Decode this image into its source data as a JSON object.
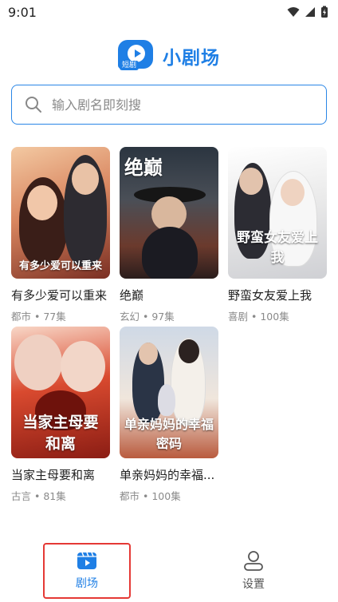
{
  "status_bar": {
    "time": "9:01"
  },
  "header": {
    "logo_tag": "短剧",
    "title": "小剧场"
  },
  "search": {
    "placeholder": "输入剧名即刻搜"
  },
  "dramas": [
    {
      "title": "有多少爱可以重来",
      "genre": "都市",
      "episodes": "77集",
      "poster_text": "有多少爱可以重来"
    },
    {
      "title": "绝巅",
      "genre": "玄幻",
      "episodes": "97集",
      "poster_text": "绝巅"
    },
    {
      "title": "野蛮女友爱上我",
      "genre": "喜剧",
      "episodes": "100集",
      "poster_text": "野蛮女友爱上我"
    },
    {
      "title": "当家主母要和离",
      "genre": "古言",
      "episodes": "81集",
      "poster_text": "当家主母要和离"
    },
    {
      "title": "单亲妈妈的幸福...",
      "genre": "都市",
      "episodes": "100集",
      "poster_text": "单亲妈妈的幸福密码"
    }
  ],
  "meta_separator": "•",
  "nav": {
    "theater_label": "剧场",
    "settings_label": "设置"
  },
  "colors": {
    "accent": "#1f7fe5",
    "highlight_border": "#e53935"
  }
}
